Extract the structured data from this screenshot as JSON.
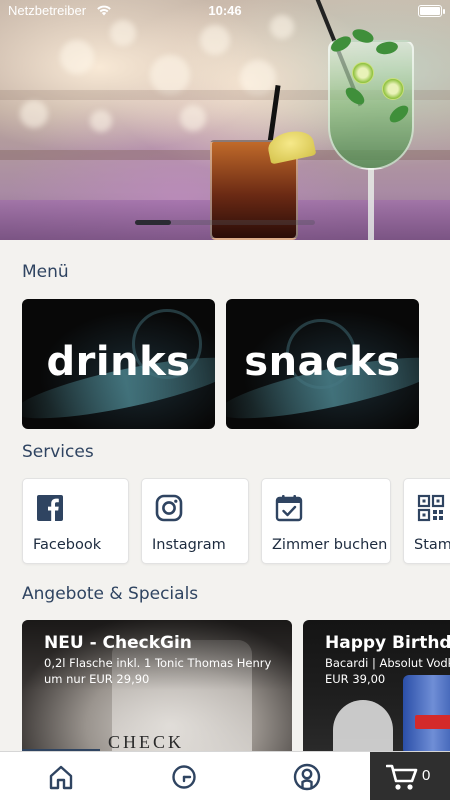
{
  "status_bar": {
    "carrier": "Netzbetreiber",
    "time": "10:46"
  },
  "sections": {
    "menu_title": "Menü",
    "services_title": "Services",
    "offers_title": "Angebote & Specials"
  },
  "menu_cards": [
    {
      "label": "drinks"
    },
    {
      "label": "snacks"
    }
  ],
  "services": [
    {
      "label": "Facebook",
      "icon": "facebook-icon"
    },
    {
      "label": "Instagram",
      "icon": "instagram-icon"
    },
    {
      "label": "Zimmer buchen",
      "icon": "calendar-check-icon"
    },
    {
      "label": "Stam",
      "icon": "qr-code-icon"
    }
  ],
  "offers": [
    {
      "title": "NEU - CheckGin",
      "line1": "0,2l Flasche inkl. 1 Tonic Thomas Henry",
      "line2": "um nur EUR 29,90"
    },
    {
      "title": "Happy Birthday",
      "line1": "Bacardi | Absolut Vodk",
      "line2": "EUR 39,00"
    }
  ],
  "tab_bar": {
    "items": [
      {
        "icon": "home-icon"
      },
      {
        "icon": "clock-icon"
      },
      {
        "icon": "profile-icon"
      }
    ],
    "cart_icon": "cart-icon",
    "cart_count": "0"
  },
  "colors": {
    "heading": "#2f4461",
    "cart_tab_bg": "#2f2f2f",
    "background": "#f3f2ef"
  }
}
